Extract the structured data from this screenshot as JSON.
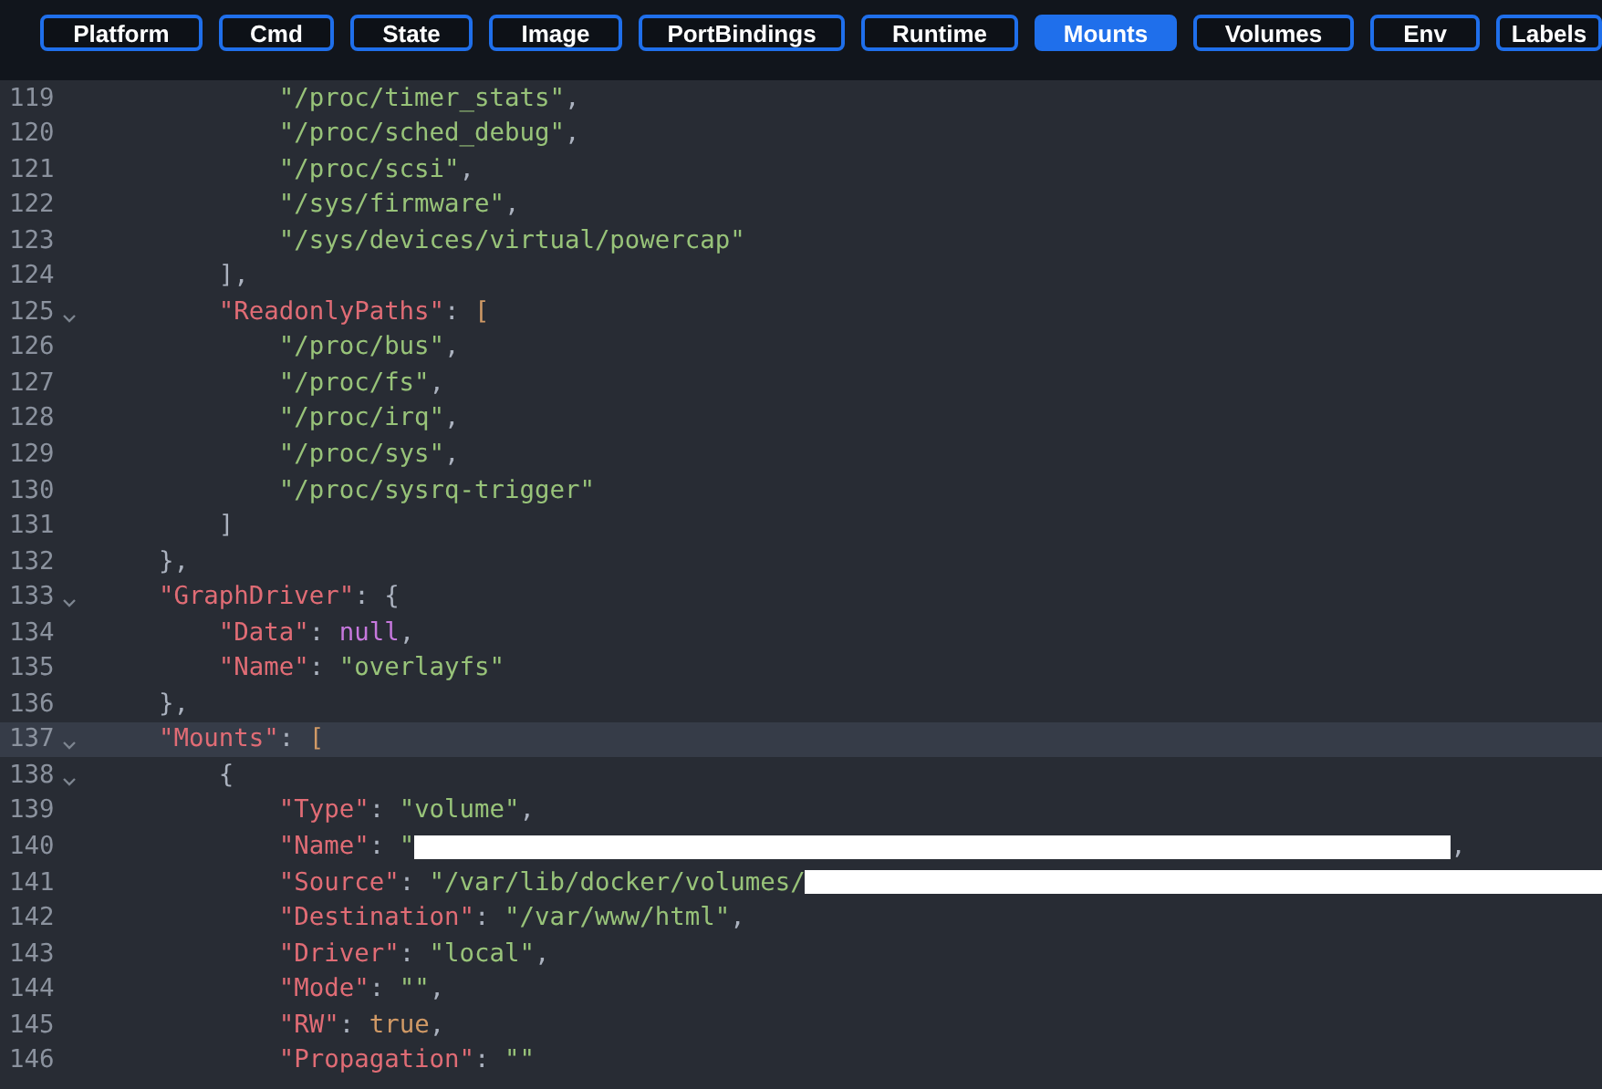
{
  "tabs": [
    {
      "label": "Platform",
      "selected": false
    },
    {
      "label": "Cmd",
      "selected": false
    },
    {
      "label": "State",
      "selected": false
    },
    {
      "label": "Image",
      "selected": false
    },
    {
      "label": "PortBindings",
      "selected": false
    },
    {
      "label": "Runtime",
      "selected": false
    },
    {
      "label": "Mounts",
      "selected": true
    },
    {
      "label": "Volumes",
      "selected": false
    },
    {
      "label": "Env",
      "selected": false
    },
    {
      "label": "Labels",
      "selected": false
    }
  ],
  "editor": {
    "lines": [
      {
        "number": "119",
        "foldable": false,
        "highlighted": false,
        "tokens": [
          {
            "kind": "string",
            "text": "            \"/proc/timer_stats\""
          },
          {
            "kind": "punct",
            "text": ","
          }
        ]
      },
      {
        "number": "120",
        "foldable": false,
        "highlighted": false,
        "tokens": [
          {
            "kind": "string",
            "text": "            \"/proc/sched_debug\""
          },
          {
            "kind": "punct",
            "text": ","
          }
        ]
      },
      {
        "number": "121",
        "foldable": false,
        "highlighted": false,
        "tokens": [
          {
            "kind": "string",
            "text": "            \"/proc/scsi\""
          },
          {
            "kind": "punct",
            "text": ","
          }
        ]
      },
      {
        "number": "122",
        "foldable": false,
        "highlighted": false,
        "tokens": [
          {
            "kind": "string",
            "text": "            \"/sys/firmware\""
          },
          {
            "kind": "punct",
            "text": ","
          }
        ]
      },
      {
        "number": "123",
        "foldable": false,
        "highlighted": false,
        "tokens": [
          {
            "kind": "string",
            "text": "            \"/sys/devices/virtual/powercap\""
          }
        ]
      },
      {
        "number": "124",
        "foldable": false,
        "highlighted": false,
        "tokens": [
          {
            "kind": "punct",
            "text": "        ],"
          }
        ]
      },
      {
        "number": "125",
        "foldable": true,
        "highlighted": false,
        "tokens": [
          {
            "kind": "key",
            "text": "        \"ReadonlyPaths\""
          },
          {
            "kind": "punct",
            "text": ": "
          },
          {
            "kind": "bracket",
            "text": "["
          }
        ]
      },
      {
        "number": "126",
        "foldable": false,
        "highlighted": false,
        "tokens": [
          {
            "kind": "string",
            "text": "            \"/proc/bus\""
          },
          {
            "kind": "punct",
            "text": ","
          }
        ]
      },
      {
        "number": "127",
        "foldable": false,
        "highlighted": false,
        "tokens": [
          {
            "kind": "string",
            "text": "            \"/proc/fs\""
          },
          {
            "kind": "punct",
            "text": ","
          }
        ]
      },
      {
        "number": "128",
        "foldable": false,
        "highlighted": false,
        "tokens": [
          {
            "kind": "string",
            "text": "            \"/proc/irq\""
          },
          {
            "kind": "punct",
            "text": ","
          }
        ]
      },
      {
        "number": "129",
        "foldable": false,
        "highlighted": false,
        "tokens": [
          {
            "kind": "string",
            "text": "            \"/proc/sys\""
          },
          {
            "kind": "punct",
            "text": ","
          }
        ]
      },
      {
        "number": "130",
        "foldable": false,
        "highlighted": false,
        "tokens": [
          {
            "kind": "string",
            "text": "            \"/proc/sysrq-trigger\""
          }
        ]
      },
      {
        "number": "131",
        "foldable": false,
        "highlighted": false,
        "tokens": [
          {
            "kind": "punct",
            "text": "        ]"
          }
        ]
      },
      {
        "number": "132",
        "foldable": false,
        "highlighted": false,
        "tokens": [
          {
            "kind": "punct",
            "text": "    },"
          }
        ]
      },
      {
        "number": "133",
        "foldable": true,
        "highlighted": false,
        "tokens": [
          {
            "kind": "key",
            "text": "    \"GraphDriver\""
          },
          {
            "kind": "punct",
            "text": ": {"
          }
        ]
      },
      {
        "number": "134",
        "foldable": false,
        "highlighted": false,
        "tokens": [
          {
            "kind": "key",
            "text": "        \"Data\""
          },
          {
            "kind": "punct",
            "text": ": "
          },
          {
            "kind": "null",
            "text": "null"
          },
          {
            "kind": "punct",
            "text": ","
          }
        ]
      },
      {
        "number": "135",
        "foldable": false,
        "highlighted": false,
        "tokens": [
          {
            "kind": "key",
            "text": "        \"Name\""
          },
          {
            "kind": "punct",
            "text": ": "
          },
          {
            "kind": "string",
            "text": "\"overlayfs\""
          }
        ]
      },
      {
        "number": "136",
        "foldable": false,
        "highlighted": false,
        "tokens": [
          {
            "kind": "punct",
            "text": "    },"
          }
        ]
      },
      {
        "number": "137",
        "foldable": true,
        "highlighted": true,
        "tokens": [
          {
            "kind": "key",
            "text": "    \"Mounts\""
          },
          {
            "kind": "punct",
            "text": ": "
          },
          {
            "kind": "bracket",
            "text": "["
          }
        ]
      },
      {
        "number": "138",
        "foldable": true,
        "highlighted": false,
        "tokens": [
          {
            "kind": "punct",
            "text": "        {"
          }
        ]
      },
      {
        "number": "139",
        "foldable": false,
        "highlighted": false,
        "tokens": [
          {
            "kind": "key",
            "text": "            \"Type\""
          },
          {
            "kind": "punct",
            "text": ": "
          },
          {
            "kind": "string",
            "text": "\"volume\""
          },
          {
            "kind": "punct",
            "text": ","
          }
        ]
      },
      {
        "number": "140",
        "foldable": false,
        "highlighted": false,
        "tokens": [
          {
            "kind": "key",
            "text": "            \"Name\""
          },
          {
            "kind": "punct",
            "text": ": "
          },
          {
            "kind": "string",
            "text": "\""
          },
          {
            "kind": "redacted"
          },
          {
            "kind": "punct",
            "text": ","
          }
        ]
      },
      {
        "number": "141",
        "foldable": false,
        "highlighted": false,
        "tokens": [
          {
            "kind": "key",
            "text": "            \"Source\""
          },
          {
            "kind": "punct",
            "text": ": "
          },
          {
            "kind": "string",
            "text": "\"/var/lib/docker/volumes/"
          },
          {
            "kind": "redacted_to_edge"
          }
        ]
      },
      {
        "number": "142",
        "foldable": false,
        "highlighted": false,
        "tokens": [
          {
            "kind": "key",
            "text": "            \"Destination\""
          },
          {
            "kind": "punct",
            "text": ": "
          },
          {
            "kind": "string",
            "text": "\"/var/www/html\""
          },
          {
            "kind": "punct",
            "text": ","
          }
        ]
      },
      {
        "number": "143",
        "foldable": false,
        "highlighted": false,
        "tokens": [
          {
            "kind": "key",
            "text": "            \"Driver\""
          },
          {
            "kind": "punct",
            "text": ": "
          },
          {
            "kind": "string",
            "text": "\"local\""
          },
          {
            "kind": "punct",
            "text": ","
          }
        ]
      },
      {
        "number": "144",
        "foldable": false,
        "highlighted": false,
        "tokens": [
          {
            "kind": "key",
            "text": "            \"Mode\""
          },
          {
            "kind": "punct",
            "text": ": "
          },
          {
            "kind": "string",
            "text": "\"\""
          },
          {
            "kind": "punct",
            "text": ","
          }
        ]
      },
      {
        "number": "145",
        "foldable": false,
        "highlighted": false,
        "tokens": [
          {
            "kind": "key",
            "text": "            \"RW\""
          },
          {
            "kind": "punct",
            "text": ": "
          },
          {
            "kind": "bool",
            "text": "true"
          },
          {
            "kind": "punct",
            "text": ","
          }
        ]
      },
      {
        "number": "146",
        "foldable": false,
        "highlighted": false,
        "tokens": [
          {
            "kind": "key",
            "text": "            \"Propagation\""
          },
          {
            "kind": "punct",
            "text": ": "
          },
          {
            "kind": "string",
            "text": "\"\""
          }
        ]
      }
    ]
  }
}
